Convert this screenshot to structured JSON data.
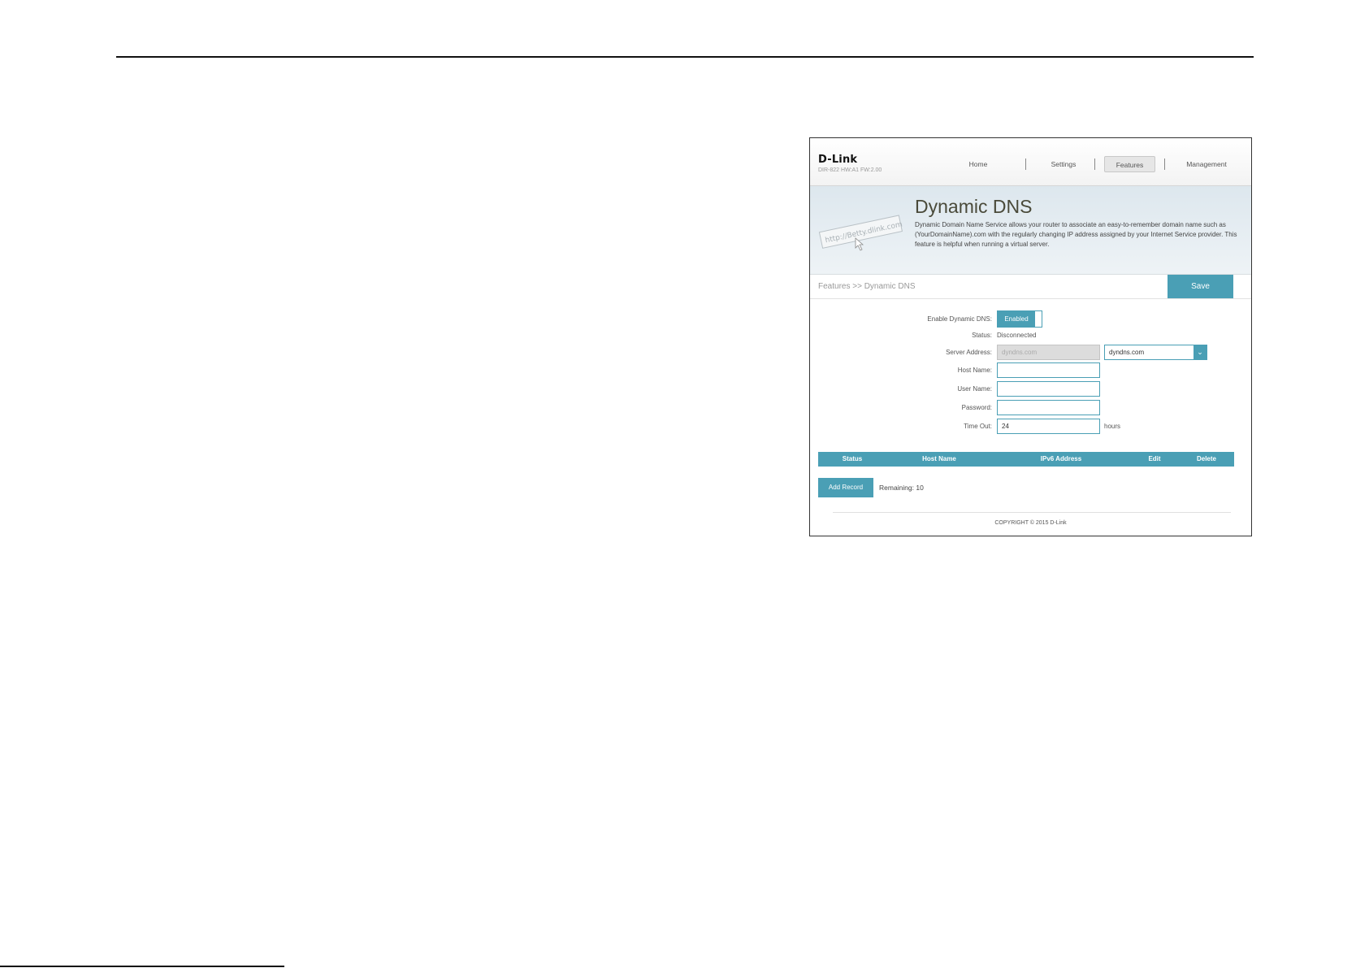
{
  "header": {
    "logo": "D-Link",
    "model": "DIR-822 HW:A1 FW:2.00",
    "nav": [
      "Home",
      "Settings",
      "Features",
      "Management"
    ],
    "active_nav": "Features"
  },
  "banner": {
    "title": "Dynamic DNS",
    "description": "Dynamic Domain Name Service allows your router to associate an easy-to-remember domain name such as (YourDomainName).com with the regularly changing IP address assigned by your Internet Service provider. This feature is helpful when running a virtual server.",
    "image_text": "http://Betty.dlink.com"
  },
  "breadcrumb": "Features >> Dynamic DNS",
  "save_label": "Save",
  "form": {
    "enable_label": "Enable Dynamic DNS:",
    "enable_value": "Enabled",
    "status_label": "Status:",
    "status_value": "Disconnected",
    "server_label": "Server Address:",
    "server_value": "dyndns.com",
    "server_select": "dyndns.com",
    "host_label": "Host Name:",
    "host_value": "",
    "user_label": "User Name:",
    "user_value": "",
    "password_label": "Password:",
    "password_value": "",
    "timeout_label": "Time Out:",
    "timeout_value": "24",
    "timeout_unit": "hours"
  },
  "table": {
    "columns": [
      "Status",
      "Host Name",
      "IPv6 Address",
      "Edit",
      "Delete"
    ]
  },
  "add_record_label": "Add Record",
  "remaining": "Remaining: 10",
  "copyright": "COPYRIGHT © 2015 D-Link",
  "colors": {
    "accent": "#4a9fb5"
  }
}
